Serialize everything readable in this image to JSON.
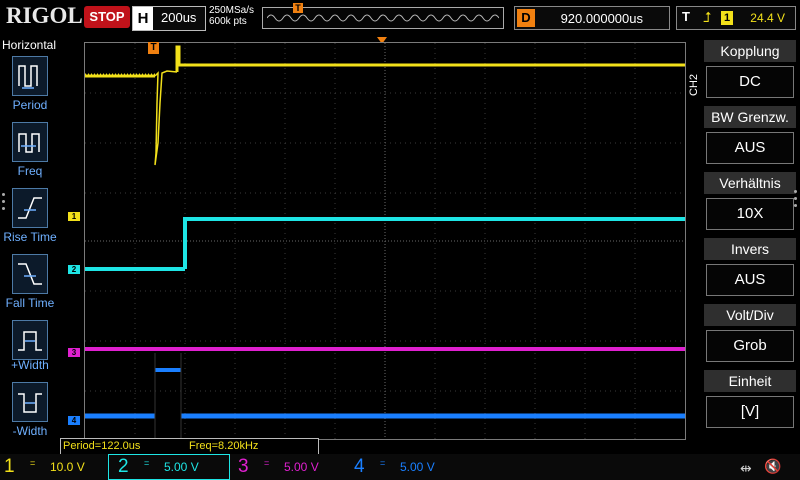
{
  "topbar": {
    "logo": "RIGOL",
    "run_status": "STOP",
    "timebase_label": "H",
    "timebase_value": "200us",
    "sample_rate": "250MSa/s",
    "memory_depth": "600k pts",
    "trigger_marker": "T",
    "delay_label": "D",
    "delay_value": "920.000000us",
    "trigger_label": "T",
    "trigger_source": "1",
    "trigger_level": "24.4 V"
  },
  "left_menu": {
    "title": "Horizontal",
    "items": [
      {
        "label": "Period",
        "icon": "period-icon"
      },
      {
        "label": "Freq",
        "icon": "freq-icon"
      },
      {
        "label": "Rise Time",
        "icon": "rise-time-icon"
      },
      {
        "label": "Fall Time",
        "icon": "fall-time-icon"
      },
      {
        "label": "+Width",
        "icon": "pos-width-icon"
      },
      {
        "label": "-Width",
        "icon": "neg-width-icon"
      }
    ]
  },
  "grid": {
    "trigger_marker": "T",
    "channel_markers": [
      {
        "label": "1",
        "color": "#f2e01a"
      },
      {
        "label": "2",
        "color": "#1ee5e5"
      },
      {
        "label": "3",
        "color": "#e020d0"
      },
      {
        "label": "4",
        "color": "#1a7fff"
      }
    ],
    "side_channel": "CH2"
  },
  "measurements": {
    "period": "Period=122.0us",
    "freq": "Freq=8.20kHz"
  },
  "right_menu": {
    "items": [
      {
        "title": "Kopplung",
        "value": "DC"
      },
      {
        "title": "BW Grenzw.",
        "value": "AUS"
      },
      {
        "title": "Verhältnis",
        "value": "10X"
      },
      {
        "title": "Invers",
        "value": "AUS"
      },
      {
        "title": "Volt/Div",
        "value": "Grob"
      },
      {
        "title": "Einheit",
        "value": "[V]"
      }
    ]
  },
  "bottombar": {
    "channels": [
      {
        "num": "1",
        "coupling": "=",
        "scale": "10.0 V",
        "color": "#f2e01a"
      },
      {
        "num": "2",
        "coupling": "=",
        "scale": "5.00 V",
        "color": "#1ee5e5"
      },
      {
        "num": "3",
        "coupling": "=",
        "scale": "5.00 V",
        "color": "#e020d0"
      },
      {
        "num": "4",
        "coupling": "=",
        "scale": "5.00 V",
        "color": "#1a7fff"
      }
    ],
    "usb_icon": "usb-icon",
    "speaker_icon": "speaker-muted-icon"
  },
  "colors": {
    "ch1": "#f2e01a",
    "ch2": "#1ee5e5",
    "ch3": "#e020d0",
    "ch4": "#1a7fff",
    "accent": "#f08010",
    "stop": "#c0121a"
  }
}
